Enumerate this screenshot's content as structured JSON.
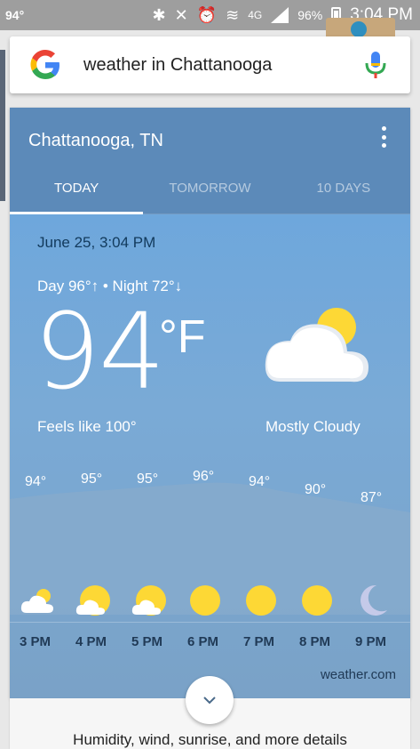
{
  "status_bar": {
    "left_text": "94°",
    "battery": "96%",
    "network": "4G",
    "time": "3:04 PM",
    "icons": [
      "bluetooth-icon",
      "mute-icon",
      "alarm-icon",
      "wifi-icon",
      "signal-icon",
      "battery-icon"
    ]
  },
  "search": {
    "query": "weather in Chattanooga"
  },
  "weather": {
    "location": "Chattanooga, TN",
    "tabs": [
      {
        "label": "TODAY",
        "active": true
      },
      {
        "label": "TOMORROW",
        "active": false
      },
      {
        "label": "10 DAYS",
        "active": false
      }
    ],
    "date_time": "June 25, 3:04 PM",
    "hi_lo": "Day 96°↑ • Night 72°↓",
    "temperature": "94",
    "unit": "°F",
    "feels_like": "Feels like 100°",
    "condition": "Mostly Cloudy",
    "source": "weather.com",
    "hourly": [
      {
        "time": "3 PM",
        "temp": "94°",
        "icon": "partly-cloudy-icon"
      },
      {
        "time": "4 PM",
        "temp": "95°",
        "icon": "partly-cloudy-icon"
      },
      {
        "time": "5 PM",
        "temp": "95°",
        "icon": "partly-cloudy-icon"
      },
      {
        "time": "6 PM",
        "temp": "96°",
        "icon": "sun-icon"
      },
      {
        "time": "7 PM",
        "temp": "94°",
        "icon": "sun-icon"
      },
      {
        "time": "8 PM",
        "temp": "90°",
        "icon": "sun-icon"
      },
      {
        "time": "9 PM",
        "temp": "87°",
        "icon": "moon-icon"
      }
    ]
  },
  "details": {
    "label": "Humidity, wind, sunrise, and more details"
  },
  "colors": {
    "card_header": "#5c8ab9",
    "card_body": "#6ea7dc",
    "sun": "#fdd835",
    "moon": "#c5cae9"
  }
}
